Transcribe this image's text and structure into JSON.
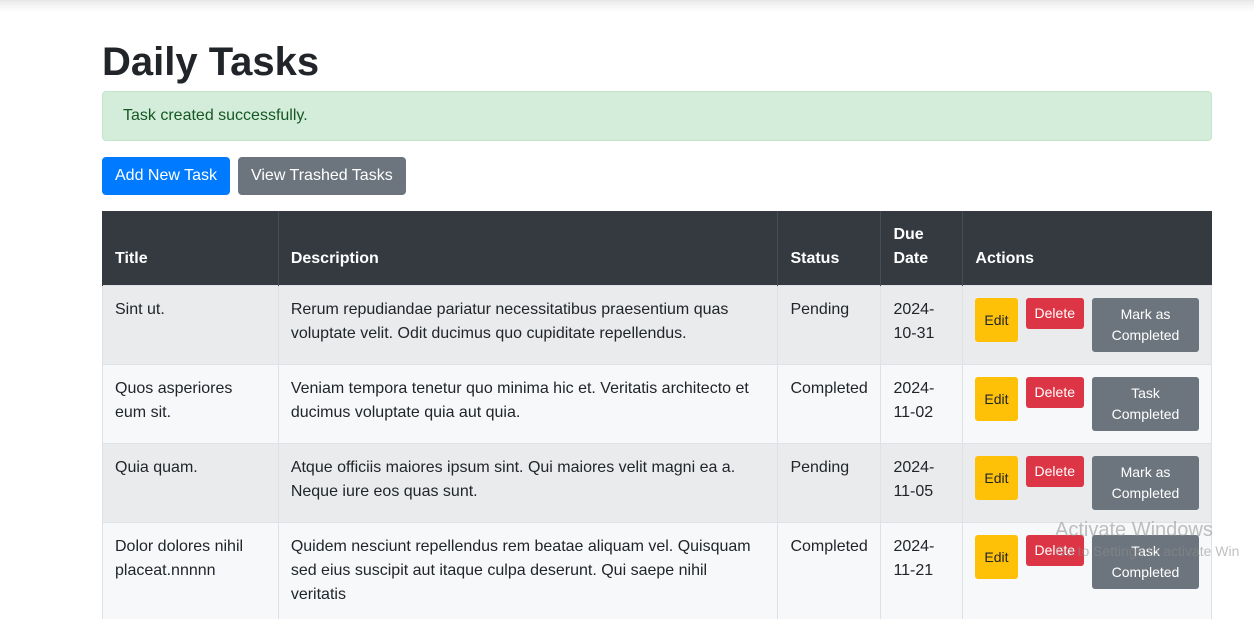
{
  "page": {
    "title": "Daily Tasks",
    "alert": "Task created successfully."
  },
  "buttons": {
    "add_new": "Add New Task",
    "view_trashed": "View Trashed Tasks"
  },
  "table": {
    "headers": [
      "Title",
      "Description",
      "Status",
      "Due\nDate",
      "Actions"
    ],
    "rows": [
      {
        "title": "Sint ut.",
        "description": "Rerum repudiandae pariatur necessitatibus praesentium quas voluptate velit. Odit ducimus quo cupiditate repellendus.",
        "status": "Pending",
        "due": "2024-\n10-31",
        "edit": "Edit",
        "delete": "Delete",
        "complete": "Mark as Completed"
      },
      {
        "title": "Quos asperiores eum sit.",
        "description": "Veniam tempora tenetur quo minima hic et. Veritatis architecto et ducimus voluptate quia aut quia.",
        "status": "Completed",
        "due": "2024-\n11-02",
        "edit": "Edit",
        "delete": "Delete",
        "complete": "Task Completed"
      },
      {
        "title": "Quia quam.",
        "description": "Atque officiis maiores ipsum sint. Qui maiores velit magni ea a. Neque iure eos quas sunt.",
        "status": "Pending",
        "due": "2024-\n11-05",
        "edit": "Edit",
        "delete": "Delete",
        "complete": "Mark as Completed"
      },
      {
        "title": "Dolor dolores nihil placeat.nnnnn",
        "description": "Quidem nesciunt repellendus rem beatae aliquam vel. Quisquam sed eius suscipit aut itaque culpa deserunt. Qui saepe nihil veritatis",
        "status": "Completed",
        "due": "2024-\n11-21",
        "edit": "Edit",
        "delete": "Delete",
        "complete": "Task Completed"
      }
    ]
  },
  "watermark": {
    "line1": "Activate Windows",
    "line2": "Go to Settings to activate Win"
  },
  "colors": {
    "primary": "#007bff",
    "secondary": "#6c757d",
    "warning": "#ffc107",
    "danger": "#dc3545",
    "header_dark": "#343a40",
    "alert_bg": "#d4edda"
  }
}
